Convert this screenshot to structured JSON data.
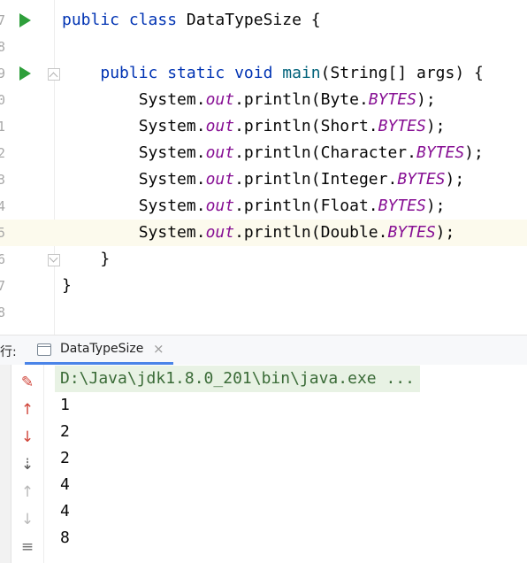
{
  "editor": {
    "lines": [
      {
        "num": "7",
        "tokens": [
          [
            "kw",
            "public "
          ],
          [
            "kw",
            "class "
          ],
          [
            "pl",
            "DataTypeSize {"
          ]
        ]
      },
      {
        "num": "8",
        "tokens": []
      },
      {
        "num": "9",
        "tokens": [
          [
            "pl",
            "    "
          ],
          [
            "kw",
            "public "
          ],
          [
            "kw",
            "static "
          ],
          [
            "kw",
            "void "
          ],
          [
            "mth",
            "main"
          ],
          [
            "pl",
            "(String[] args) {"
          ]
        ]
      },
      {
        "num": "0",
        "tokens": [
          [
            "pl",
            "        System."
          ],
          [
            "fld",
            "out"
          ],
          [
            "pl",
            ".println(Byte."
          ],
          [
            "fld",
            "BYTES"
          ],
          [
            "pl",
            ");"
          ]
        ]
      },
      {
        "num": "1",
        "tokens": [
          [
            "pl",
            "        System."
          ],
          [
            "fld",
            "out"
          ],
          [
            "pl",
            ".println(Short."
          ],
          [
            "fld",
            "BYTES"
          ],
          [
            "pl",
            ");"
          ]
        ]
      },
      {
        "num": "2",
        "tokens": [
          [
            "pl",
            "        System."
          ],
          [
            "fld",
            "out"
          ],
          [
            "pl",
            ".println(Character."
          ],
          [
            "fld",
            "BYTES"
          ],
          [
            "pl",
            ");"
          ]
        ]
      },
      {
        "num": "3",
        "tokens": [
          [
            "pl",
            "        System."
          ],
          [
            "fld",
            "out"
          ],
          [
            "pl",
            ".println(Integer."
          ],
          [
            "fld",
            "BYTES"
          ],
          [
            "pl",
            ");"
          ]
        ]
      },
      {
        "num": "4",
        "tokens": [
          [
            "pl",
            "        System."
          ],
          [
            "fld",
            "out"
          ],
          [
            "pl",
            ".println(Float."
          ],
          [
            "fld",
            "BYTES"
          ],
          [
            "pl",
            ");"
          ]
        ]
      },
      {
        "num": "5",
        "tokens": [
          [
            "pl",
            "        System."
          ],
          [
            "fld",
            "out"
          ],
          [
            "pl",
            ".println(Double."
          ],
          [
            "fld",
            "BYTES"
          ],
          [
            "pl",
            ");"
          ]
        ]
      },
      {
        "num": "6",
        "tokens": [
          [
            "pl",
            "    }"
          ]
        ]
      },
      {
        "num": "7",
        "tokens": [
          [
            "pl",
            "}"
          ]
        ]
      },
      {
        "num": "8",
        "tokens": []
      }
    ]
  },
  "run_panel": {
    "label": "行:",
    "tab_label": "DataTypeSize",
    "close_glyph": "×"
  },
  "console": {
    "command": "D:\\Java\\jdk1.8.0_201\\bin\\java.exe ...",
    "outputs": [
      "1",
      "2",
      "2",
      "4",
      "4",
      "8"
    ]
  },
  "toolbar_icons": [
    {
      "name": "stop-icon",
      "glyph": "✎",
      "color": "#d0453a"
    },
    {
      "name": "up-arrow-icon",
      "glyph": "↑",
      "color": "#d0453a"
    },
    {
      "name": "down-arrow-icon",
      "glyph": "↓",
      "color": "#d0453a"
    },
    {
      "name": "sort-icon",
      "glyph": "⇣",
      "color": "#555555"
    },
    {
      "name": "scroll-up-icon",
      "glyph": "↑",
      "color": "#b9b9b9"
    },
    {
      "name": "scroll-down-icon",
      "glyph": "↓",
      "color": "#b9b9b9"
    },
    {
      "name": "wrap-icon",
      "glyph": "≡",
      "color": "#6e6e6e"
    }
  ],
  "colors": {
    "keyword": "#0033b3",
    "method": "#00627a",
    "field": "#871094",
    "run_arrow": "#2e9f3b"
  }
}
